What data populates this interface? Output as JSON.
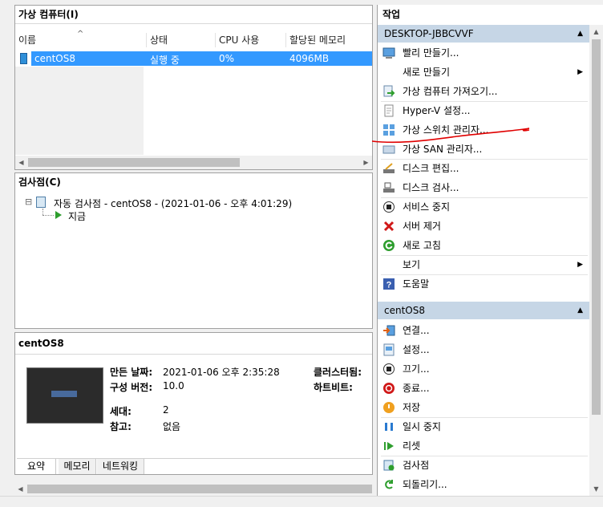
{
  "vm_panel": {
    "title": "가상 컴퓨터(I)",
    "columns": [
      "이름",
      "상태",
      "CPU 사용",
      "할당된 메모리"
    ],
    "sort_indicator": "^",
    "rows": [
      {
        "name": "centOS8",
        "state": "실행 중",
        "cpu": "0%",
        "memory": "4096MB"
      }
    ]
  },
  "checkpoint_panel": {
    "title": "검사점(C)",
    "tree": {
      "expand": "⊟",
      "snapshot": "자동 검사점 - centOS8 - (2021-01-06 - 오후 4:01:29)",
      "now": "지금"
    }
  },
  "detail_panel": {
    "title": "centOS8",
    "fields": {
      "created_label": "만든 날짜:",
      "created_value": "2021-01-06 오후 2:35:28",
      "version_label": "구성 버전:",
      "version_value": "10.0",
      "generation_label": "세대:",
      "generation_value": "2",
      "notes_label": "참고:",
      "notes_value": "없음",
      "cluster_label": "클러스터됨:",
      "heartbeat_label": "하트비트:"
    },
    "tabs": [
      "요약",
      "메모리",
      "네트워킹"
    ]
  },
  "actions_panel": {
    "title": "작업",
    "host_group": {
      "name": "DESKTOP-JBBCVVF",
      "items": [
        {
          "label": "빨리 만들기...",
          "icon": "quick-create-icon"
        },
        {
          "label": "새로 만들기",
          "icon": "none",
          "submenu": "▶"
        },
        {
          "label": "가상 컴퓨터 가져오기...",
          "icon": "import-vm-icon"
        },
        {
          "label": "Hyper-V 설정...",
          "icon": "settings-doc-icon"
        },
        {
          "label": "가상 스위치 관리자...",
          "icon": "virtual-switch-icon"
        },
        {
          "label": "가상 SAN 관리자...",
          "icon": "virtual-san-icon"
        },
        {
          "label": "디스크 편집...",
          "icon": "edit-disk-icon"
        },
        {
          "label": "디스크 검사...",
          "icon": "inspect-disk-icon"
        },
        {
          "label": "서비스 중지",
          "icon": "stop-service-icon"
        },
        {
          "label": "서버 제거",
          "icon": "remove-server-icon"
        },
        {
          "label": "새로 고침",
          "icon": "refresh-icon"
        },
        {
          "label": "보기",
          "icon": "none",
          "submenu": "▶"
        },
        {
          "label": "도움말",
          "icon": "help-icon"
        }
      ]
    },
    "vm_group": {
      "name": "centOS8",
      "items": [
        {
          "label": "연결...",
          "icon": "connect-icon"
        },
        {
          "label": "설정...",
          "icon": "vm-settings-icon"
        },
        {
          "label": "끄기...",
          "icon": "turn-off-icon"
        },
        {
          "label": "종료...",
          "icon": "shutdown-icon"
        },
        {
          "label": "저장",
          "icon": "save-icon"
        },
        {
          "label": "일시 중지",
          "icon": "pause-icon"
        },
        {
          "label": "리셋",
          "icon": "reset-icon"
        },
        {
          "label": "검사점",
          "icon": "checkpoint-icon"
        },
        {
          "label": "되돌리기...",
          "icon": "revert-icon"
        }
      ]
    },
    "collapse_glyph": "▲"
  },
  "colors": {
    "selection": "#3399ff",
    "group_header": "#c6d6e6",
    "annotation": "#e00000"
  }
}
